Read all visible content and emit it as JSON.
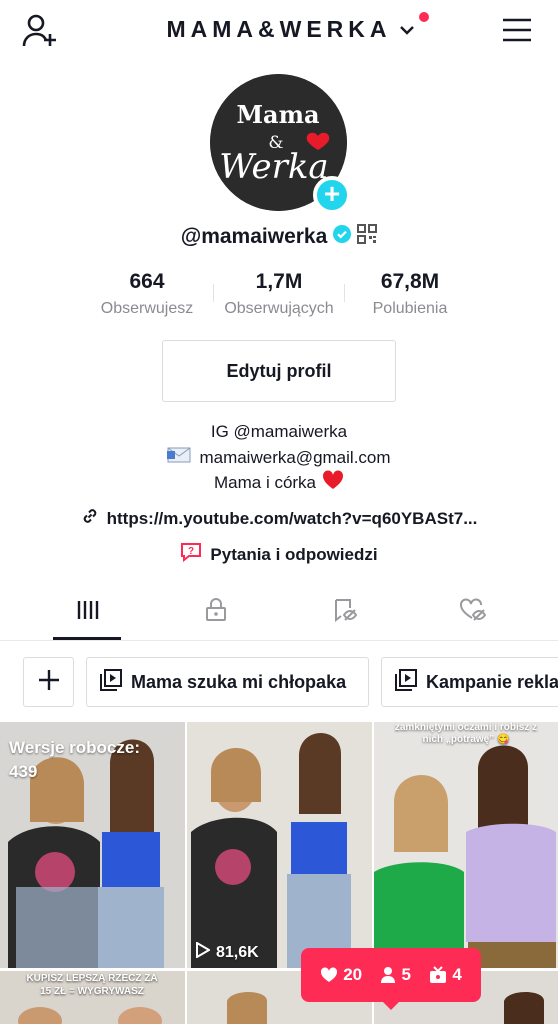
{
  "header": {
    "account_name": "MAMA&WERKA",
    "add_friend_icon": "person-plus-icon",
    "menu_icon": "hamburger-menu-icon",
    "notification_color": "#fe2c55"
  },
  "profile": {
    "avatar_text_top": "Mama",
    "avatar_text_amp": "&",
    "avatar_text_bottom": "Werka",
    "username": "@mamaiwerka",
    "verified": true,
    "accent_color": "#20d5ec"
  },
  "stats": [
    {
      "value": "664",
      "label": "Obserwujesz"
    },
    {
      "value": "1,7M",
      "label": "Obserwujących"
    },
    {
      "value": "67,8M",
      "label": "Polubienia"
    }
  ],
  "edit_profile_label": "Edytuj profil",
  "bio": {
    "line1": "IG  @mamaiwerka",
    "line2": "mamaiwerka@gmail.com",
    "line3": "Mama i córka",
    "link": "https://m.youtube.com/watch?v=q60YBASt7...",
    "qa": "Pytania i odpowiedzi"
  },
  "tabs": [
    "videos-grid",
    "private",
    "favorites",
    "liked"
  ],
  "playlists": [
    "Mama szuka mi chłopaka",
    "Kampanie rekla"
  ],
  "grid": {
    "drafts_label": "Wersje robocze:",
    "drafts_count": "439",
    "video2_views": "81,6K",
    "video3_caption": "zamkniętymi oczami i robisz z nich „potrawę” 😋",
    "row2_caption": "KUPISZ LEPSZĄ RZECZ ZA 15 ZŁ = WYGRYWASZ"
  },
  "notifications": {
    "likes": "20",
    "followers": "5",
    "comments": "4"
  }
}
